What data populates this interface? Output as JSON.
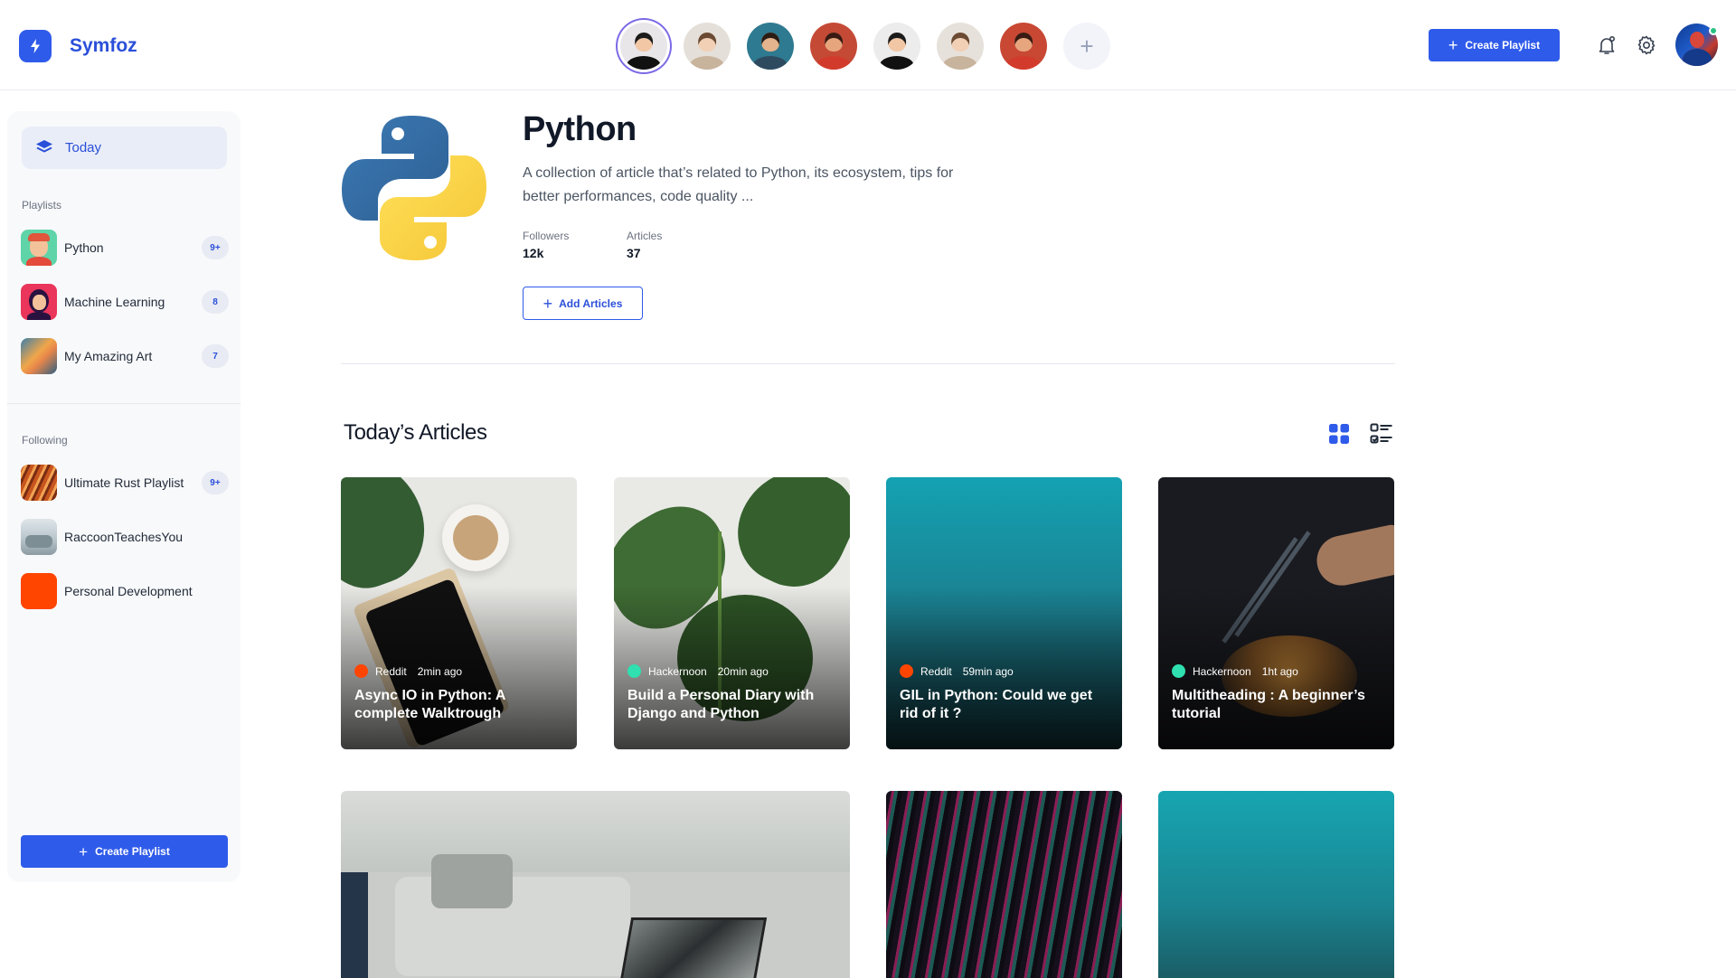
{
  "app": {
    "name": "Symfoz"
  },
  "topbar": {
    "create_label": "Create Playlist",
    "avatars": [
      {
        "skin": "#f1c7a6",
        "hair": "#1b1b1b",
        "shirt": "#111111",
        "bg": "#e9e6ea",
        "active": true
      },
      {
        "skin": "#f1d0b6",
        "hair": "#6b4a33",
        "shirt": "#c8b39c",
        "bg": "#e4dfd8"
      },
      {
        "skin": "#e3b48d",
        "hair": "#2b1d14",
        "shirt": "#2e4a5f",
        "bg": "#2e7a90"
      },
      {
        "skin": "#e7a57e",
        "hair": "#3a1a12",
        "shirt": "#d23b2b",
        "bg": "#c54a36"
      },
      {
        "skin": "#f1c7a6",
        "hair": "#1b1b1b",
        "shirt": "#111111",
        "bg": "#ececec"
      },
      {
        "skin": "#f1d0b6",
        "hair": "#6b4a33",
        "shirt": "#c8b39c",
        "bg": "#e6e1db"
      },
      {
        "skin": "#e7a57e",
        "hair": "#3a1a12",
        "shirt": "#d23b2b",
        "bg": "#c84834"
      }
    ]
  },
  "sidebar": {
    "today_label": "Today",
    "playlists_label": "Playlists",
    "playlists": [
      {
        "label": "Python",
        "badge": "9+",
        "thumb": "python-avatar"
      },
      {
        "label": "Machine Learning",
        "badge": "8",
        "thumb": "ml-avatar"
      },
      {
        "label": "My Amazing Art",
        "badge": "7",
        "thumb": "art-avatar"
      }
    ],
    "following_label": "Following",
    "following": [
      {
        "label": "Ultimate Rust Playlist",
        "badge": "9+"
      },
      {
        "label": "RaccoonTeachesYou",
        "badge": ""
      },
      {
        "label": "Personal Development",
        "badge": ""
      }
    ],
    "create_label": "Create Playlist"
  },
  "playlist": {
    "title": "Python",
    "description": "A collection of article that’s related to Python, its ecosystem, tips for better performances, code quality ...",
    "followers_label": "Followers",
    "followers_value": "12k",
    "articles_label": "Articles",
    "articles_value": "37",
    "add_label": "Add Articles"
  },
  "articles": {
    "section_title": "Today’s Articles",
    "cards": [
      {
        "source": "Reddit",
        "time": "2min ago",
        "title": "Async IO in Python: A complete Walktrough",
        "dot": "#ff4500"
      },
      {
        "source": "Hackernoon",
        "time": "20min ago",
        "title": "Build a Personal Diary with Django and Python",
        "dot": "#2fe0b0"
      },
      {
        "source": "Reddit",
        "time": "59min ago",
        "title": "GIL in Python: Could we get rid of it ?",
        "dot": "#ff4500"
      },
      {
        "source": "Hackernoon",
        "time": "1ht ago",
        "title": "Multitheading : A beginner’s tutorial",
        "dot": "#2fe0b0"
      }
    ]
  },
  "colors": {
    "accent": "#2f5bea",
    "reddit": "#ff4500",
    "hackernoon": "#2fe0b0"
  }
}
